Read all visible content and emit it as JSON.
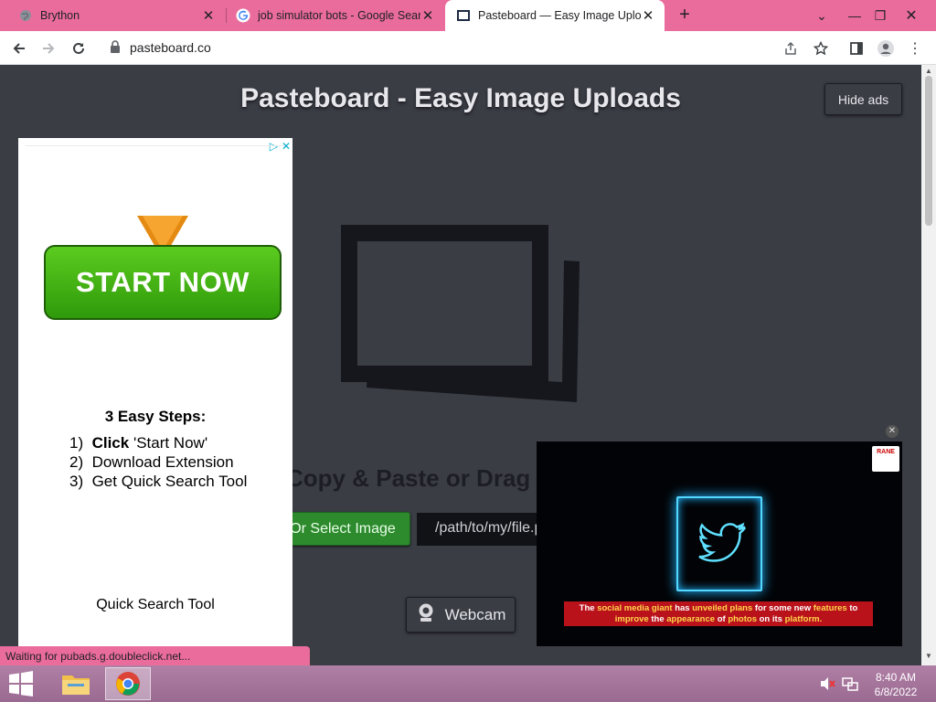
{
  "browser": {
    "tabs": [
      {
        "title": "Brython",
        "icon": "globe-icon"
      },
      {
        "title": "job simulator bots - Google Sear",
        "icon": "google-icon"
      },
      {
        "title": "Pasteboard — Easy Image Uploa",
        "icon": "pasteboard-icon"
      }
    ],
    "url": "pasteboard.co",
    "status": "Waiting for pubads.g.doubleclick.net..."
  },
  "page": {
    "title": "Pasteboard - Easy Image Uploads",
    "hide_ads": "Hide ads",
    "copy_paste": "Copy & Paste or Drag",
    "select_image": "Or Select Image",
    "path_placeholder": "/path/to/my/file.png",
    "webcam": "Webcam"
  },
  "ad": {
    "start_now": "START NOW",
    "steps_title": "3 Easy Steps:",
    "steps": [
      {
        "num": "1)",
        "bold": "Click",
        "text": " 'Start Now'"
      },
      {
        "num": "2)",
        "bold": "",
        "text": "Download Extension"
      },
      {
        "num": "3)",
        "bold": "",
        "text": "Get Quick Search Tool"
      }
    ],
    "footer": "Quick Search Tool"
  },
  "video": {
    "caption_parts": [
      {
        "t": "The ",
        "hl": false
      },
      {
        "t": "social media giant",
        "hl": true
      },
      {
        "t": " has ",
        "hl": false
      },
      {
        "t": "unveiled plans",
        "hl": true
      },
      {
        "t": " for some new ",
        "hl": false
      },
      {
        "t": "features",
        "hl": true
      },
      {
        "t": " to ",
        "hl": false
      },
      {
        "t": "improve",
        "hl": true
      },
      {
        "t": " the ",
        "hl": false
      },
      {
        "t": "appearance",
        "hl": true
      },
      {
        "t": " of ",
        "hl": false
      },
      {
        "t": "photos",
        "hl": true
      },
      {
        "t": " on its ",
        "hl": false
      },
      {
        "t": "platform.",
        "hl": true
      }
    ],
    "logo_text": "RANE"
  },
  "taskbar": {
    "time": "8:40 AM",
    "date": "6/8/2022"
  },
  "colors": {
    "tab_strip": "#ea6c9c",
    "page_bg": "#3b3d45",
    "select_button": "#2d8a2d"
  }
}
